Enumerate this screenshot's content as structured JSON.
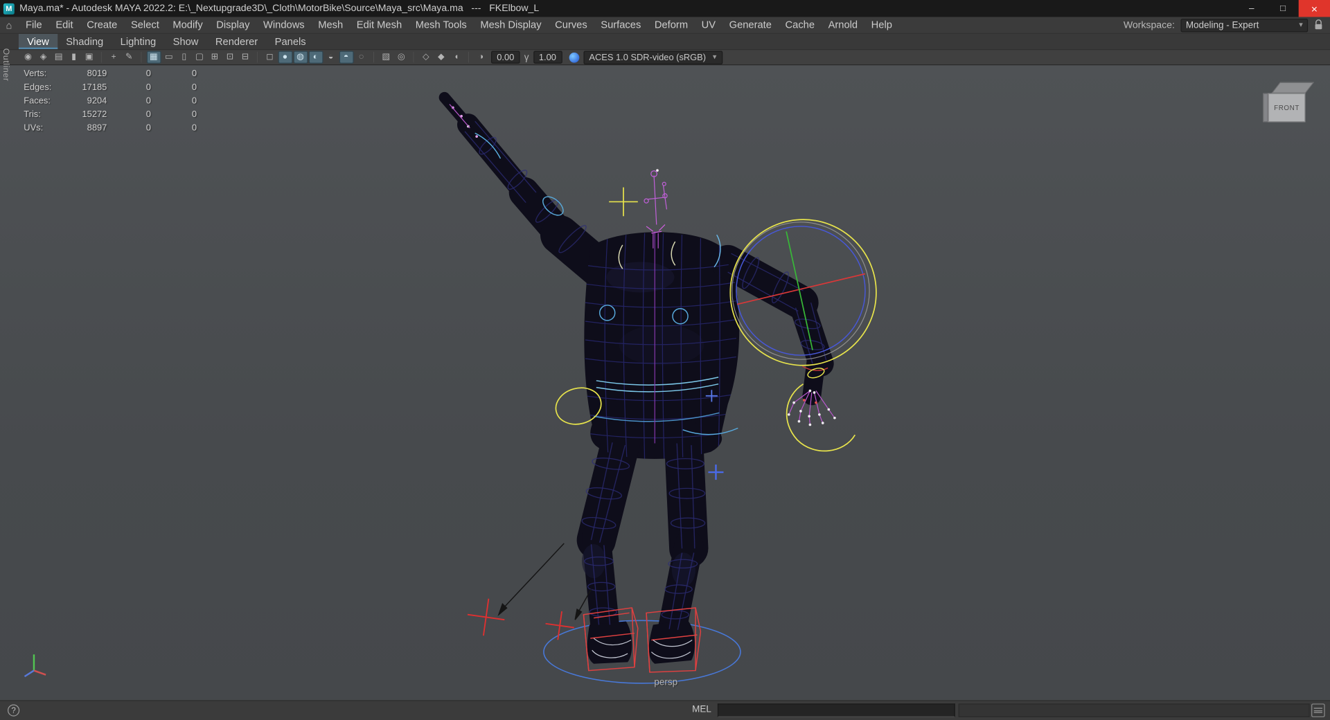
{
  "title_bar": {
    "app_badge": "M",
    "title": "Maya.ma* - Autodesk MAYA 2022.2: E:\\_Nextupgrade3D\\_Cloth\\MotorBike\\Source\\Maya_src\\Maya.ma   ---   FKElbow_L",
    "window_controls": {
      "minimize": "–",
      "restore": "□",
      "close": "×"
    }
  },
  "menu_bar": {
    "home_icon": "⌂",
    "items": [
      "File",
      "Edit",
      "Create",
      "Select",
      "Modify",
      "Display",
      "Windows",
      "Mesh",
      "Edit Mesh",
      "Mesh Tools",
      "Mesh Display",
      "Curves",
      "Surfaces",
      "Deform",
      "UV",
      "Generate",
      "Cache",
      "Arnold",
      "Help"
    ],
    "workspace": {
      "label": "Workspace:",
      "value": "Modeling - Expert",
      "caret": "▾"
    }
  },
  "panel_menu": {
    "items": [
      "View",
      "Shading",
      "Lighting",
      "Show",
      "Renderer",
      "Panels"
    ],
    "active": "View"
  },
  "panel_toolbar": {
    "icons": [
      {
        "name": "select-camera-icon",
        "glyph": "◉"
      },
      {
        "name": "lock-camera-icon",
        "glyph": "◈"
      },
      {
        "name": "camera-attributes-icon",
        "glyph": "▤"
      },
      {
        "name": "bookmark-icon",
        "glyph": "▮"
      },
      {
        "name": "image-plane-icon",
        "glyph": "▣"
      },
      {
        "name": "separator"
      },
      {
        "name": "2d-pan-zoom-icon",
        "glyph": "+"
      },
      {
        "name": "grease-pencil-icon",
        "glyph": "✎"
      },
      {
        "name": "separator"
      },
      {
        "name": "grid-icon",
        "glyph": "▦",
        "active": true
      },
      {
        "name": "film-gate-icon",
        "glyph": "▭"
      },
      {
        "name": "resolution-gate-icon",
        "glyph": "▯"
      },
      {
        "name": "gate-mask-icon",
        "glyph": "▢"
      },
      {
        "name": "field-chart-icon",
        "glyph": "⊞"
      },
      {
        "name": "safe-action-icon",
        "glyph": "⊡"
      },
      {
        "name": "safe-title-icon",
        "glyph": "⊟"
      },
      {
        "name": "separator"
      },
      {
        "name": "wireframe-mode-icon",
        "glyph": "◻"
      },
      {
        "name": "smooth-shade-icon",
        "glyph": "●",
        "active": true
      },
      {
        "name": "textured-icon",
        "glyph": "◍",
        "active": true
      },
      {
        "name": "use-all-lights-icon",
        "glyph": "◐",
        "active": true
      },
      {
        "name": "shadows-icon",
        "glyph": "◒"
      },
      {
        "name": "screen-space-ao-icon",
        "glyph": "◓",
        "active": true
      },
      {
        "name": "motion-blur-icon",
        "glyph": "◌"
      },
      {
        "name": "separator"
      },
      {
        "name": "multisample-aa-icon",
        "glyph": "▧"
      },
      {
        "name": "depth-of-field-icon",
        "glyph": "◎"
      },
      {
        "name": "separator"
      },
      {
        "name": "isolate-select-icon",
        "glyph": "◇"
      },
      {
        "name": "xray-icon",
        "glyph": "◆"
      },
      {
        "name": "xray-joints-icon",
        "glyph": "◖"
      },
      {
        "name": "separator"
      }
    ],
    "exposure_value": "0.00",
    "gamma_glyph": "γ",
    "gamma_value": "1.00",
    "color_space": "ACES 1.0 SDR-video (sRGB)",
    "caret": "▾"
  },
  "hud": {
    "rows": [
      {
        "label": "Verts:",
        "total": "8019",
        "col2": "0",
        "col3": "0"
      },
      {
        "label": "Edges:",
        "total": "17185",
        "col2": "0",
        "col3": "0"
      },
      {
        "label": "Faces:",
        "total": "9204",
        "col2": "0",
        "col3": "0"
      },
      {
        "label": "Tris:",
        "total": "15272",
        "col2": "0",
        "col3": "0"
      },
      {
        "label": "UVs:",
        "total": "8897",
        "col2": "0",
        "col3": "0"
      }
    ]
  },
  "viewport": {
    "camera_label": "persp",
    "view_cube_face": "FRONT"
  },
  "panels": {
    "outliner_tab": "Outliner"
  },
  "status_bar": {
    "help_icon": "?",
    "mel_label": "MEL",
    "command_value": ""
  },
  "colors": {
    "accent": "#5285a6",
    "viewport_bg": "#4a4d50",
    "manipulator_yellow": "#e8e44c",
    "axis_red": "#d83838",
    "axis_green": "#38b838",
    "axis_blue": "#4858d8",
    "control_red": "#e03030"
  }
}
